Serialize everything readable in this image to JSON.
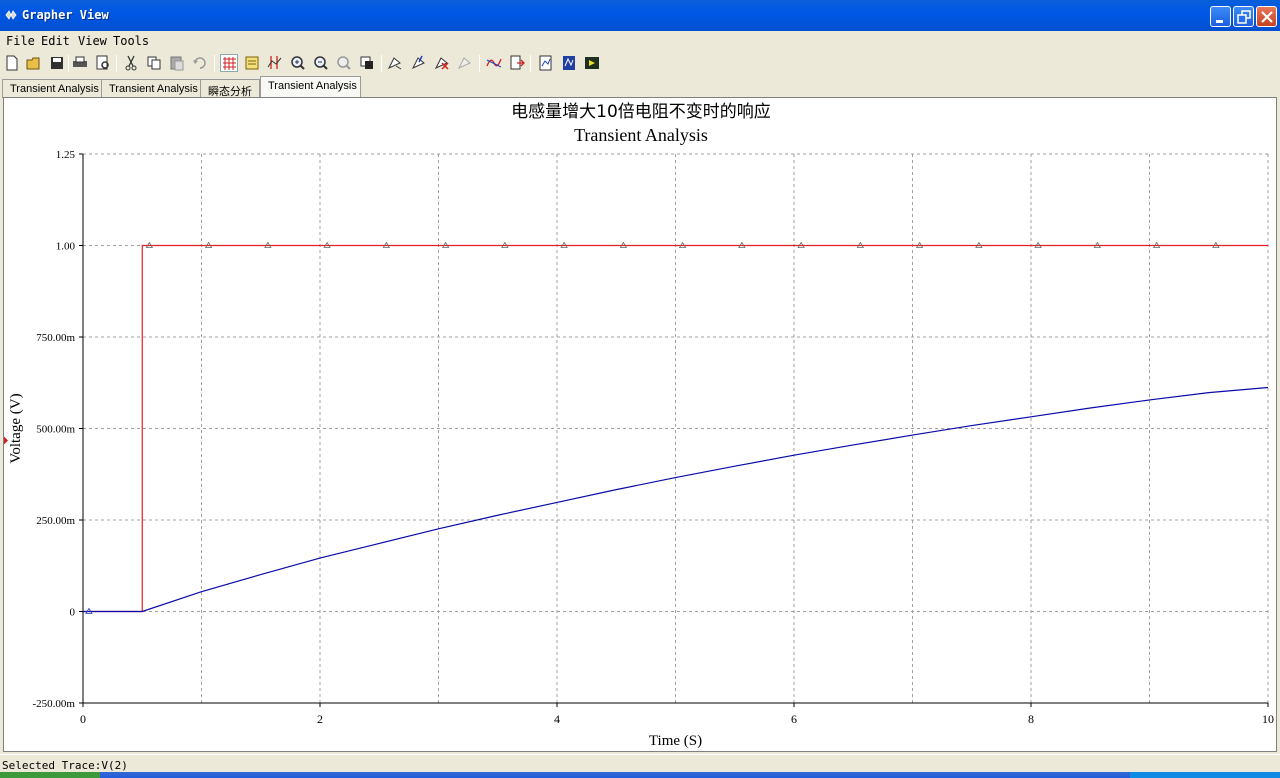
{
  "window": {
    "title": "Grapher View"
  },
  "menu": [
    "File",
    "Edit",
    "View",
    "Tools"
  ],
  "tabs": [
    {
      "label": "Transient Analysis"
    },
    {
      "label": "Transient Analysis"
    },
    {
      "label": "瞬态分析"
    },
    {
      "label": "Transient Analysis",
      "selected": true
    }
  ],
  "toolbar_icons": [
    "new-file-icon",
    "open-file-icon",
    "save-icon",
    "print-icon",
    "print-preview-icon",
    "cut-icon",
    "copy-icon",
    "paste-icon",
    "undo-icon",
    "grid-icon",
    "legend-icon",
    "cursor-icon",
    "zoom-in-icon",
    "zoom-out-icon",
    "zoom-fit-icon",
    "reverse-colors-icon",
    "select-mark-icon",
    "mark-icon",
    "clear-mark-icon",
    "mark-disabled-icon",
    "trace-icon",
    "export-icon",
    "overlay-icon",
    "properties-icon",
    "excel-export-icon"
  ],
  "status": {
    "selected_trace": "Selected Trace:V(2)"
  },
  "colors": {
    "trace_red": "#E0202A",
    "trace_blue": "#0A0AAA",
    "grid": "#A0A0A0",
    "titlebar": "#0054E3"
  },
  "chart_data": {
    "type": "line",
    "title": "电感量增大10倍电阻不变时的响应",
    "subtitle": "Transient Analysis",
    "xlabel": "Time (S)",
    "ylabel": "Voltage (V)",
    "xlim": [
      0,
      10
    ],
    "ylim": [
      -0.25,
      1.25
    ],
    "x_ticks": [
      "0",
      "2",
      "4",
      "6",
      "8",
      "10"
    ],
    "y_ticks": [
      {
        "value": 1.25,
        "label": "1.25"
      },
      {
        "value": 1.0,
        "label": "1.00"
      },
      {
        "value": 0.75,
        "label": "750.00m"
      },
      {
        "value": 0.5,
        "label": "500.00m"
      },
      {
        "value": 0.25,
        "label": "250.00m"
      },
      {
        "value": 0,
        "label": "0"
      },
      {
        "value": -0.25,
        "label": "-250.00m"
      }
    ],
    "grid": true,
    "series": [
      {
        "color": "#E0202A",
        "marker": "triangle",
        "x": [
          0,
          0.5,
          0.5,
          10
        ],
        "y": [
          0,
          0,
          1.0,
          1.0
        ],
        "marker_x": [
          0.56,
          1.06,
          1.56,
          2.06,
          2.56,
          3.06,
          3.56,
          4.06,
          4.56,
          5.06,
          5.56,
          6.06,
          6.56,
          7.06,
          7.56,
          8.06,
          8.56,
          9.06,
          9.56
        ],
        "marker_y": 1.0
      },
      {
        "color": "#0A0AAA",
        "x": [
          0,
          0.5,
          1.0,
          1.5,
          2.0,
          2.5,
          3.0,
          3.5,
          4.0,
          4.5,
          5.0,
          5.5,
          6.0,
          6.5,
          7.0,
          7.5,
          8.0,
          8.5,
          9.0,
          9.5,
          10.0
        ],
        "y": [
          0,
          0,
          0.054,
          0.101,
          0.146,
          0.186,
          0.226,
          0.263,
          0.298,
          0.333,
          0.366,
          0.397,
          0.427,
          0.455,
          0.482,
          0.508,
          0.532,
          0.556,
          0.578,
          0.598,
          0.612
        ]
      }
    ]
  }
}
